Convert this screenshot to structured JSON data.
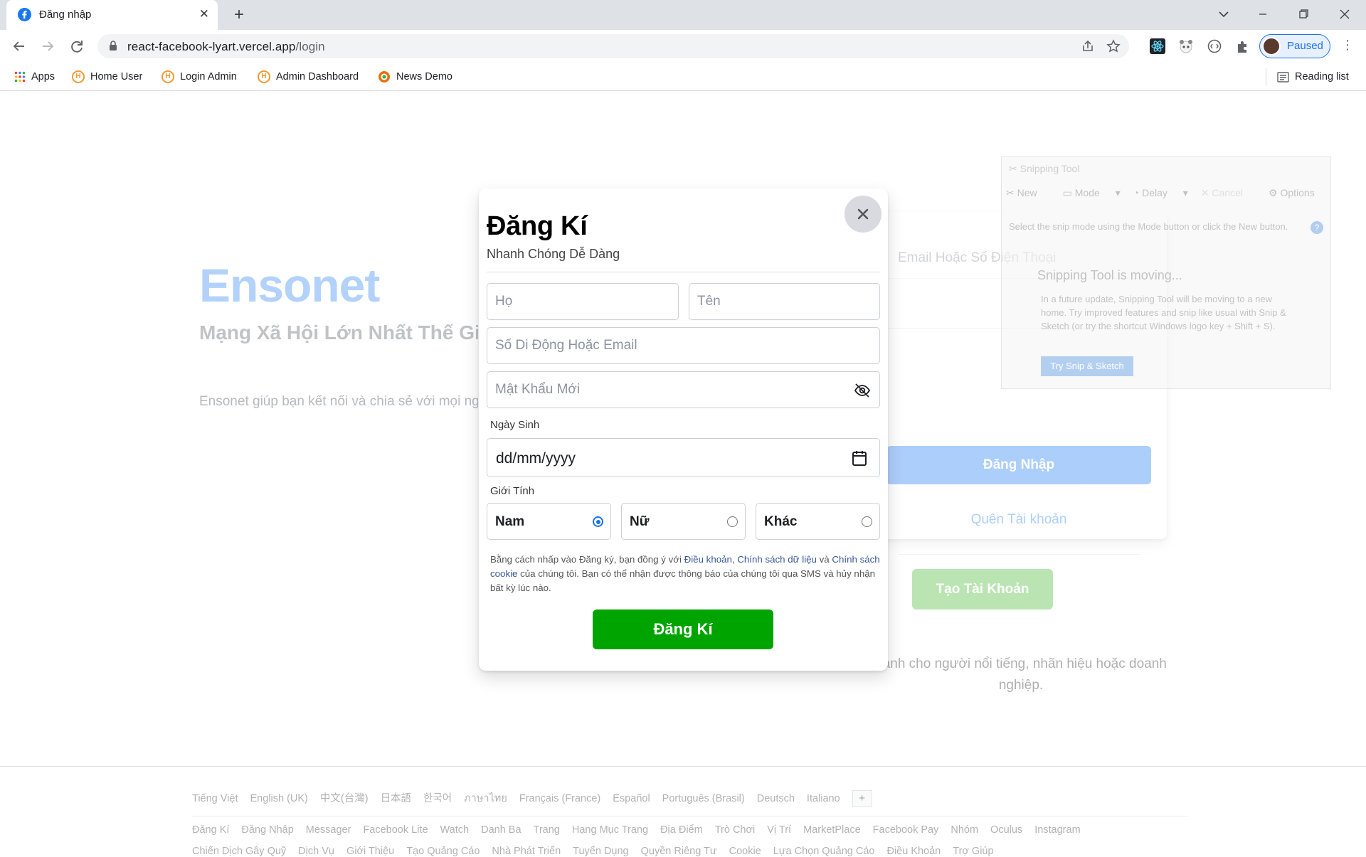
{
  "browser": {
    "tab_title": "Đăng nhập",
    "url_host": "react-facebook-lyart.vercel.app",
    "url_path": "/login",
    "profile_label": "Paused",
    "bookmarks": [
      "Apps",
      "Home User",
      "Login Admin",
      "Admin Dashboard",
      "News Demo"
    ],
    "reading_list": "Reading list"
  },
  "page": {
    "brand": "Ensonet",
    "slogan": "Mạng Xã Hội Lớn Nhất Thế Giới",
    "description": "Ensonet giúp bạn kết nối và chia sẻ với mọi người",
    "login_placeholder": "Email Hoặc Số Điện Thoại",
    "login_button": "Đăng Nhập",
    "forgot_link": "Quên Tài khoản",
    "create_button": "Tạo Tài Khoản",
    "page_note": "dành cho người nổi tiếng, nhãn hiệu hoặc doanh nghiệp."
  },
  "footer": {
    "languages": [
      "Tiếng Việt",
      "English (UK)",
      "中文(台灣)",
      "日本語",
      "한국어",
      "ภาษาไทย",
      "Français (France)",
      "Español",
      "Português (Brasil)",
      "Deutsch",
      "Italiano"
    ],
    "lang_more": "+",
    "links_row1": [
      "Đăng Kí",
      "Đăng Nhập",
      "Messager",
      "Facebook Lite",
      "Watch",
      "Danh Ba",
      "Trang",
      "Hạng Mục Trang",
      "Địa Điểm",
      "Trò Chơi",
      "Vị Trí",
      "MarketPlace",
      "Facebook Pay",
      "Nhóm",
      "Oculus",
      "Instagram"
    ],
    "links_row2": [
      "Chiến Dịch Gây Quỹ",
      "Dịch Vụ",
      "Giới Thiệu",
      "Tạo Quảng Cáo",
      "Nhà Phát Triển",
      "Tuyển Dụng",
      "Quyền Riêng Tư",
      "Cookie",
      "Lựa Chọn Quảng Cáo",
      "Điều Khoản",
      "Trợ Giúp"
    ]
  },
  "snipping_tool": {
    "title": "Snipping Tool",
    "tools": [
      "New",
      "Mode",
      "Delay",
      "Cancel",
      "Options"
    ],
    "hint": "Select the snip mode using the Mode button or click the New button.",
    "moving_title": "Snipping Tool is moving...",
    "moving_body": "In a future update, Snipping Tool will be moving to a new home. Try improved features and snip like usual with Snip & Sketch (or try the shortcut Windows logo key + Shift + S).",
    "try_button": "Try Snip & Sketch"
  },
  "signup": {
    "title": "Đăng Kí",
    "subtitle": "Nhanh Chóng Dễ Dàng",
    "first_name_placeholder": "Họ",
    "last_name_placeholder": "Tên",
    "contact_placeholder": "Số Di Động Hoặc Email",
    "password_placeholder": "Mật Khẩu Mới",
    "dob_label": "Ngày Sinh",
    "dob_value": "dd/mm/yyyy",
    "gender_label": "Giới Tính",
    "genders": [
      {
        "label": "Nam",
        "selected": true
      },
      {
        "label": "Nữ",
        "selected": false
      },
      {
        "label": "Khác",
        "selected": false
      }
    ],
    "terms_prefix": "Bằng cách nhấp vào Đăng ký, bạn đồng ý với ",
    "terms_link1": "Điều khoản",
    "terms_sep": ", ",
    "terms_link2": "Chính sách dữ liệu",
    "terms_mid": " và ",
    "terms_link3": "Chính sách cookie",
    "terms_suffix": " của chúng tôi. Bạn có thể nhận được thông báo của chúng tôi qua SMS và hủy nhận bất kỳ lúc nào.",
    "submit_label": "Đăng Kí"
  },
  "colors": {
    "brand_blue": "#1877f2",
    "signup_green": "#00a400",
    "create_green": "#42b72a"
  }
}
